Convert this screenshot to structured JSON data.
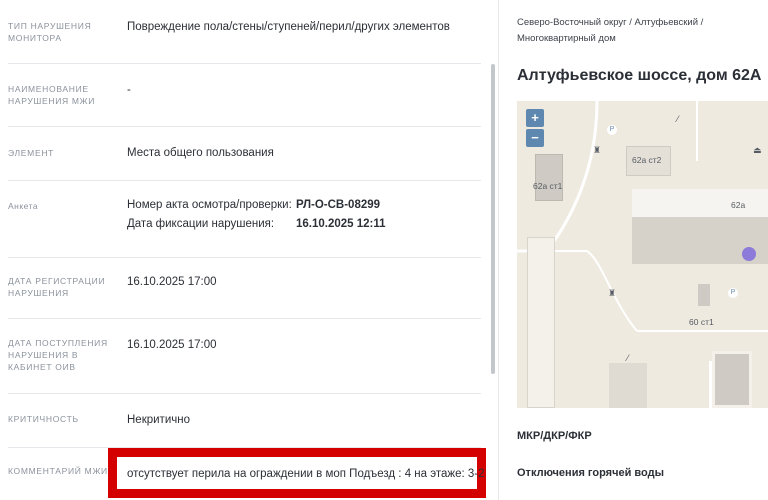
{
  "fields": {
    "type": {
      "label": "ТИП НАРУШЕНИЯ МОНИТОРА",
      "value": "Повреждение пола/стены/ступеней/перил/других элементов"
    },
    "name": {
      "label": "НАИМЕНОВАНИЕ НАРУШЕНИЯ МЖИ",
      "value": "-"
    },
    "element": {
      "label": "ЭЛЕМЕНТ",
      "value": "Места общего пользования"
    },
    "survey": {
      "label": "Анкета",
      "act_key": "Номер акта осмотра/проверки:",
      "act_value": "РЛ-О-СВ-08299",
      "date_key": "Дата фиксации нарушения:",
      "date_value": "16.10.2025 12:11"
    },
    "reg_date": {
      "label": "ДАТА РЕГИСТРАЦИИ НАРУШЕНИЯ",
      "value": "16.10.2025 17:00"
    },
    "receipt_date": {
      "label": "ДАТА ПОСТУПЛЕНИЯ НАРУШЕНИЯ В КАБИНЕТ ОИВ",
      "value": "16.10.2025 17:00"
    },
    "criticality": {
      "label": "КРИТИЧНОСТЬ",
      "value": "Некритично"
    },
    "comment": {
      "label": "КОММЕНТАРИЙ МЖИ",
      "value": "отсутствует перила на ограждении в моп Подъезд : 4 на этаже: 3-2"
    }
  },
  "location": {
    "breadcrumb": "Северо-Восточный округ / Алтуфьевский / Многоквартирный дом",
    "address": "Алтуфьевское шоссе, дом 62А",
    "map": {
      "zoom_in": "+",
      "zoom_out": "−",
      "labels": {
        "b1": "62а ст1",
        "b2": "62а ст2",
        "b3": "62а",
        "b4": "60 ст1"
      },
      "parking": "P"
    },
    "section_title": "МКР/ДКР/ФКР",
    "section_sub": "Отключения горячей воды"
  },
  "colors": {
    "highlight": "#d40000",
    "accent_dot": "#8c7bd8",
    "zoom_button": "#5e88b0"
  },
  "icons": [
    "zoom-in-icon",
    "zoom-out-icon",
    "map-marker-icon",
    "parking-icon"
  ]
}
